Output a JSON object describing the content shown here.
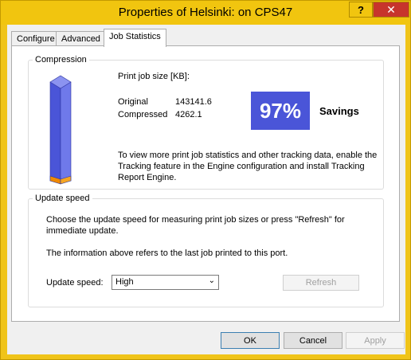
{
  "window": {
    "title": "Properties of Helsinki: on CPS47",
    "help_glyph": "?",
    "close_glyph": "✕"
  },
  "tabs": [
    {
      "label": "Configure",
      "active": false
    },
    {
      "label": "Advanced",
      "active": false
    },
    {
      "label": "Job Statistics",
      "active": true
    }
  ],
  "compression": {
    "group_title": "Compression",
    "size_heading": "Print job size [KB]:",
    "original_label": "Original",
    "original_value": "143141.6",
    "compressed_label": "Compressed",
    "compressed_value": "4262.1",
    "percent": "97%",
    "savings_label": "Savings",
    "bar_compressed_fraction": 0.03,
    "bar_color": "#4a55d8",
    "bar_fill_color": "#f08a00",
    "info_line1": "To view more print job statistics and other tracking data, enable the",
    "info_line2": "Tracking feature in the Engine configuration and install Tracking",
    "info_line3": "Report Engine."
  },
  "update_speed": {
    "group_title": "Update speed",
    "desc_line1": "Choose the update speed for measuring print job sizes or press \"Refresh\" for",
    "desc_line2": "immediate update.",
    "info_line": "The information above refers to the last job printed to this port.",
    "speed_label": "Update speed:",
    "speed_value": "High",
    "refresh_label": "Refresh"
  },
  "buttons": {
    "ok": "OK",
    "cancel": "Cancel",
    "apply": "Apply"
  }
}
